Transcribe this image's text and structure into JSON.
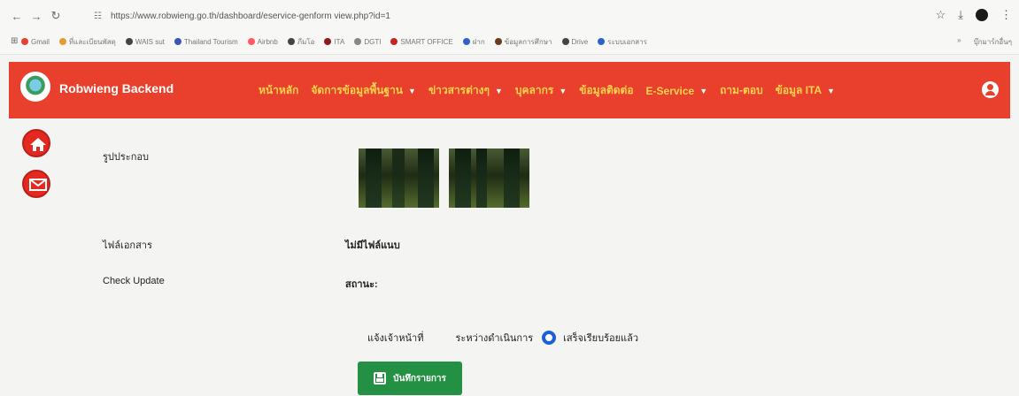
{
  "browser": {
    "url": "https://www.robwieng.go.th/dashboard/eservice-genform view.php?id=1",
    "bookmarks": [
      "Gmail",
      "ที่และเบียนพัสดุ",
      "WAIS sut",
      "Thailand Tourism",
      "Airbnb",
      "ภีมโอ",
      "ITA",
      "DGTI",
      "SMART OFFICE",
      "ฝาก",
      "ข้อมูลการศึกษา",
      "Drive",
      "ระบบเอกสาร"
    ],
    "other_bookmarks": "บุ๊กมาร์กอื่นๆ"
  },
  "navbar": {
    "brand": "Robwieng Backend",
    "menu": [
      {
        "label": "หน้าหลัก",
        "dropdown": false
      },
      {
        "label": "จัดการข้อมูลพื้นฐาน",
        "dropdown": true
      },
      {
        "label": "ข่าวสารต่างๆ",
        "dropdown": true
      },
      {
        "label": "บุคลากร",
        "dropdown": true
      },
      {
        "label": "ข้อมูลติดต่อ",
        "dropdown": false
      },
      {
        "label": "E-Service",
        "dropdown": true
      },
      {
        "label": "ถาม-ตอบ",
        "dropdown": false
      },
      {
        "label": "ข้อมูล ITA",
        "dropdown": true
      }
    ]
  },
  "form": {
    "attachments_label": "รูปประกอบ",
    "document_label": "ไฟล์เอกสาร",
    "document_value": "ไม่มีไฟล์แนบ",
    "check_update_label": "Check Update",
    "status_label": "สถานะ:",
    "notify_label": "แจ้งเจ้าหน้าที่",
    "option_processing": "ระหว่างดำเนินการ",
    "option_done": "เสร็จเรียบร้อยแล้ว",
    "selected_option": "เสร็จเรียบร้อยแล้ว",
    "save_label": "บันทึกรายการ"
  },
  "colors": {
    "navbar": "#e8402c",
    "menu_text": "#ffd34d",
    "save_button": "#249043",
    "radio": "#1e5fd6"
  }
}
